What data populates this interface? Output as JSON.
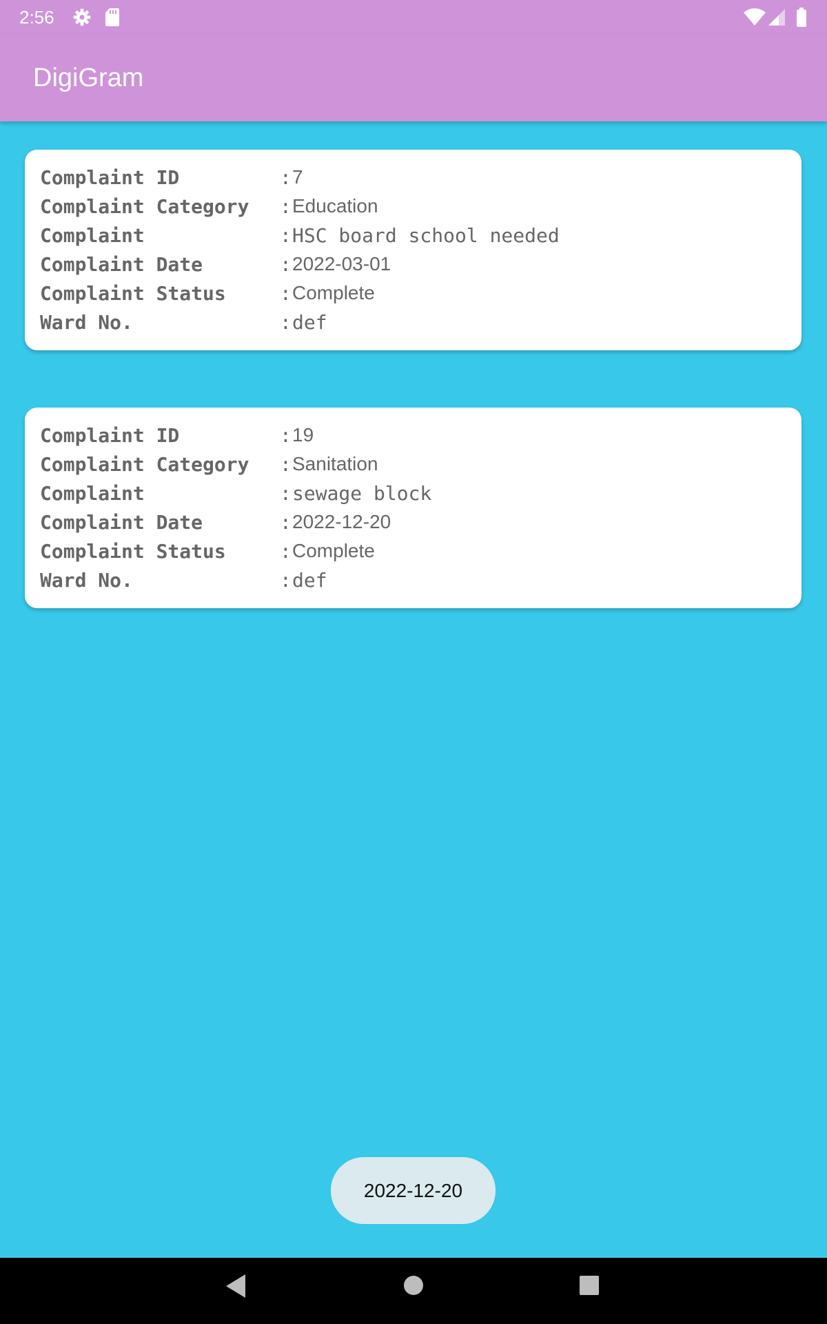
{
  "status_bar": {
    "time": "2:56",
    "icons": [
      "gear-icon",
      "sd-card-icon",
      "wifi-icon",
      "signal-icon",
      "battery-icon"
    ]
  },
  "app_bar": {
    "title": "DigiGram"
  },
  "labels": {
    "id": "Complaint ID",
    "category": "Complaint Category",
    "complaint": "Complaint",
    "date": "Complaint Date",
    "status": "Complaint Status",
    "ward": "Ward No.",
    "separator": ":"
  },
  "complaints": [
    {
      "id": "7",
      "category": "Education",
      "complaint": "HSC board school needed",
      "date": "2022-03-01",
      "status": "Complete",
      "ward": "def"
    },
    {
      "id": "19",
      "category": "Sanitation",
      "complaint": "sewage block",
      "date": "2022-12-20",
      "status": "Complete",
      "ward": "def"
    }
  ],
  "toast": {
    "text": "2022-12-20"
  },
  "nav_bar": {
    "icons": [
      "back-icon",
      "home-icon",
      "recents-icon"
    ]
  },
  "colors": {
    "app_bar": "#cf93da",
    "background": "#38c8e9",
    "card": "#ffffff",
    "toast": "#dbeaee",
    "nav_bar": "#000000"
  }
}
